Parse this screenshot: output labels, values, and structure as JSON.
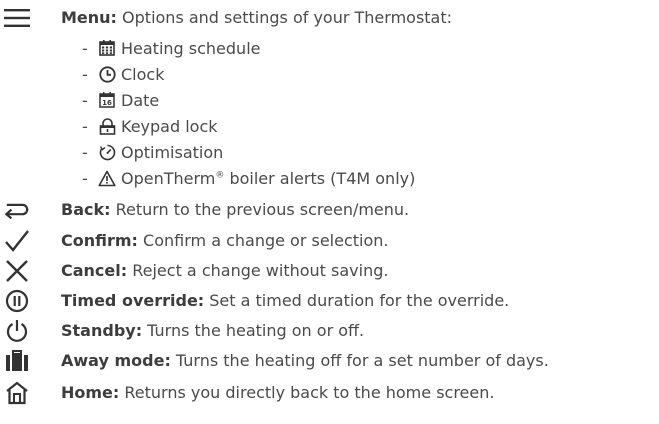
{
  "menu": {
    "label": "Menu:",
    "desc": " Options and settings of your Thermostat:",
    "icon": "hamburger-menu-icon",
    "items": [
      {
        "label": "Heating schedule",
        "icon": "calendar-grid-icon"
      },
      {
        "label": "Clock",
        "icon": "clock-icon"
      },
      {
        "label": "Date",
        "icon": "date-16-icon"
      },
      {
        "label": "Keypad lock",
        "icon": "padlock-icon"
      },
      {
        "label": "Optimisation",
        "icon": "optimisation-gauge-icon"
      },
      {
        "label_prefix": "OpenTherm",
        "label_mark": "®",
        "label_suffix": " boiler alerts (T4M only)",
        "icon": "warning-triangle-icon"
      }
    ],
    "dash": "-"
  },
  "entries": [
    {
      "label": "Back:",
      "desc": " Return to the previous screen/menu.",
      "icon": "back-arrow-icon"
    },
    {
      "label": "Confirm:",
      "desc": " Confirm a change or selection.",
      "icon": "checkmark-icon"
    },
    {
      "label": "Cancel:",
      "desc": " Reject a change without saving.",
      "icon": "cross-icon"
    },
    {
      "label": "Timed override:",
      "desc": " Set a timed duration for the override.",
      "icon": "timed-override-icon"
    },
    {
      "label": "Standby:",
      "desc": " Turns the heating on or off.",
      "icon": "power-icon"
    },
    {
      "label": "Away mode:",
      "desc": " Turns the heating off for a set number of days.",
      "icon": "suitcase-icon"
    },
    {
      "label": "Home:",
      "desc": " Returns you directly back to the home screen.",
      "icon": "home-icon"
    }
  ],
  "colors": {
    "text": "#4a4a4a",
    "icon": "#333333"
  }
}
